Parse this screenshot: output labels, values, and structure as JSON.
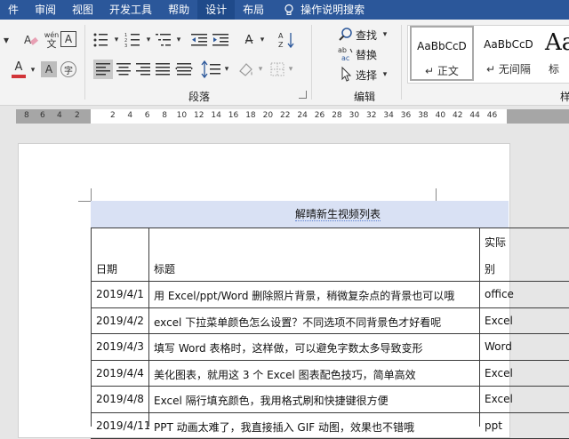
{
  "menu": {
    "tabs": [
      "件",
      "审阅",
      "视图",
      "开发工具",
      "帮助",
      "设计",
      "布局"
    ],
    "active_tab": "设计",
    "tell_me": "操作说明搜索"
  },
  "ribbon": {
    "paragraph_group": "段落",
    "editing_group": "编辑",
    "find": "查找",
    "replace": "替换",
    "select": "选择",
    "styles": [
      {
        "sample": "AaBbCcD",
        "name": "正文"
      },
      {
        "sample": "AaBbCcD",
        "name": "无间隔"
      },
      {
        "sample": "Aa",
        "name": "标"
      }
    ],
    "styles_group_fragment": "样",
    "wen_glyph": "wén",
    "font_color": "#d13438",
    "highlight_char": "A"
  },
  "ruler": {
    "left_numbers": [
      "8",
      "6",
      "4",
      "2"
    ],
    "right_numbers": [
      "2",
      "4",
      "6",
      "8",
      "10",
      "12",
      "14",
      "16",
      "18",
      "20",
      "22",
      "24",
      "26",
      "28",
      "30",
      "32",
      "34",
      "36",
      "38",
      "40",
      "42",
      "44",
      "46"
    ]
  },
  "document": {
    "table_title": "解晴新生视频列表",
    "headers": {
      "date": "日期",
      "title": "标题",
      "category_top": "实际",
      "category_bottom": "别"
    },
    "rows": [
      {
        "date": "2019/4/1",
        "title": "用 Excel/ppt/Word 删除照片背景，稍微复杂点的背景也可以哦",
        "category": "office"
      },
      {
        "date": "2019/4/2",
        "title": "excel 下拉菜单颜色怎么设置？不同选项不同背景色才好看呢",
        "category": "Excel"
      },
      {
        "date": "2019/4/3",
        "title": "填写 Word 表格时，这样做，可以避免字数太多导致变形",
        "category": "Word"
      },
      {
        "date": "2019/4/4",
        "title": "美化图表，就用这 3 个 Excel 图表配色技巧，简单高效",
        "category": "Excel"
      },
      {
        "date": "2019/4/8",
        "title": "Excel 隔行填充颜色，我用格式刷和快捷键很方便",
        "category": "Excel"
      },
      {
        "date": "2019/4/11",
        "title": "PPT 动画太难了，我直接插入 GIF 动图，效果也不错哦",
        "category": "ppt"
      }
    ]
  }
}
